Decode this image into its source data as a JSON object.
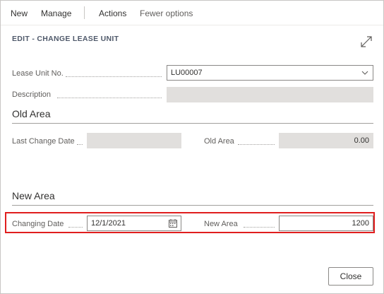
{
  "toolbar": {
    "new_label": "New",
    "manage_label": "Manage",
    "actions_label": "Actions",
    "fewer_options_label": "Fewer options"
  },
  "dialog": {
    "title": "EDIT - CHANGE LEASE UNIT"
  },
  "fields": {
    "lease_unit_no": {
      "label": "Lease Unit No.",
      "value": "LU00007"
    },
    "description": {
      "label": "Description",
      "value": ""
    }
  },
  "old_area": {
    "heading": "Old Area",
    "last_change_date": {
      "label": "Last Change Date",
      "value": ""
    },
    "old_area": {
      "label": "Old Area",
      "value": "0.00"
    }
  },
  "new_area": {
    "heading": "New Area",
    "changing_date": {
      "label": "Changing Date",
      "value": "12/1/2021"
    },
    "new_area": {
      "label": "New Area",
      "value": "1200"
    }
  },
  "footer": {
    "close_label": "Close"
  },
  "colors": {
    "highlight": "#e01e1e",
    "title": "#505a6b"
  },
  "icons": {
    "expand": "expand-icon",
    "dropdown": "chevron-down-icon",
    "calendar": "calendar-icon"
  }
}
